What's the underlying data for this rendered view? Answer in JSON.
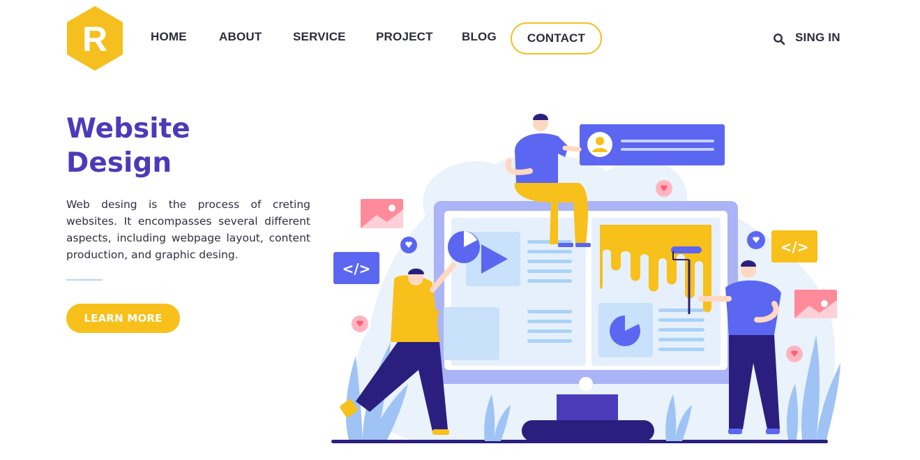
{
  "brand": {
    "logo_letter": "R",
    "logo_color": "#f5bf1f"
  },
  "nav": {
    "items": [
      {
        "label": "HOME"
      },
      {
        "label": "ABOUT"
      },
      {
        "label": "SERVICE"
      },
      {
        "label": "PROJECT"
      },
      {
        "label": "BLOG"
      }
    ],
    "contact_label": "CONTACT",
    "search_icon": "search-icon",
    "signin_label": "SING IN"
  },
  "hero": {
    "title_line1": "Website",
    "title_line2": "Design",
    "description": "Web desing is the process of creting websites. It encompasses several different aspects, including webpage layout, content production, and graphic desing.",
    "cta_label": "LEARN MORE"
  },
  "illustration": {
    "code_tag_left": "</>",
    "code_tag_right": "</>"
  },
  "colors": {
    "primary": "#4b3bb9",
    "accent": "#f7c01a",
    "blue": "#5b67f0",
    "navy": "#2a1f7e"
  }
}
